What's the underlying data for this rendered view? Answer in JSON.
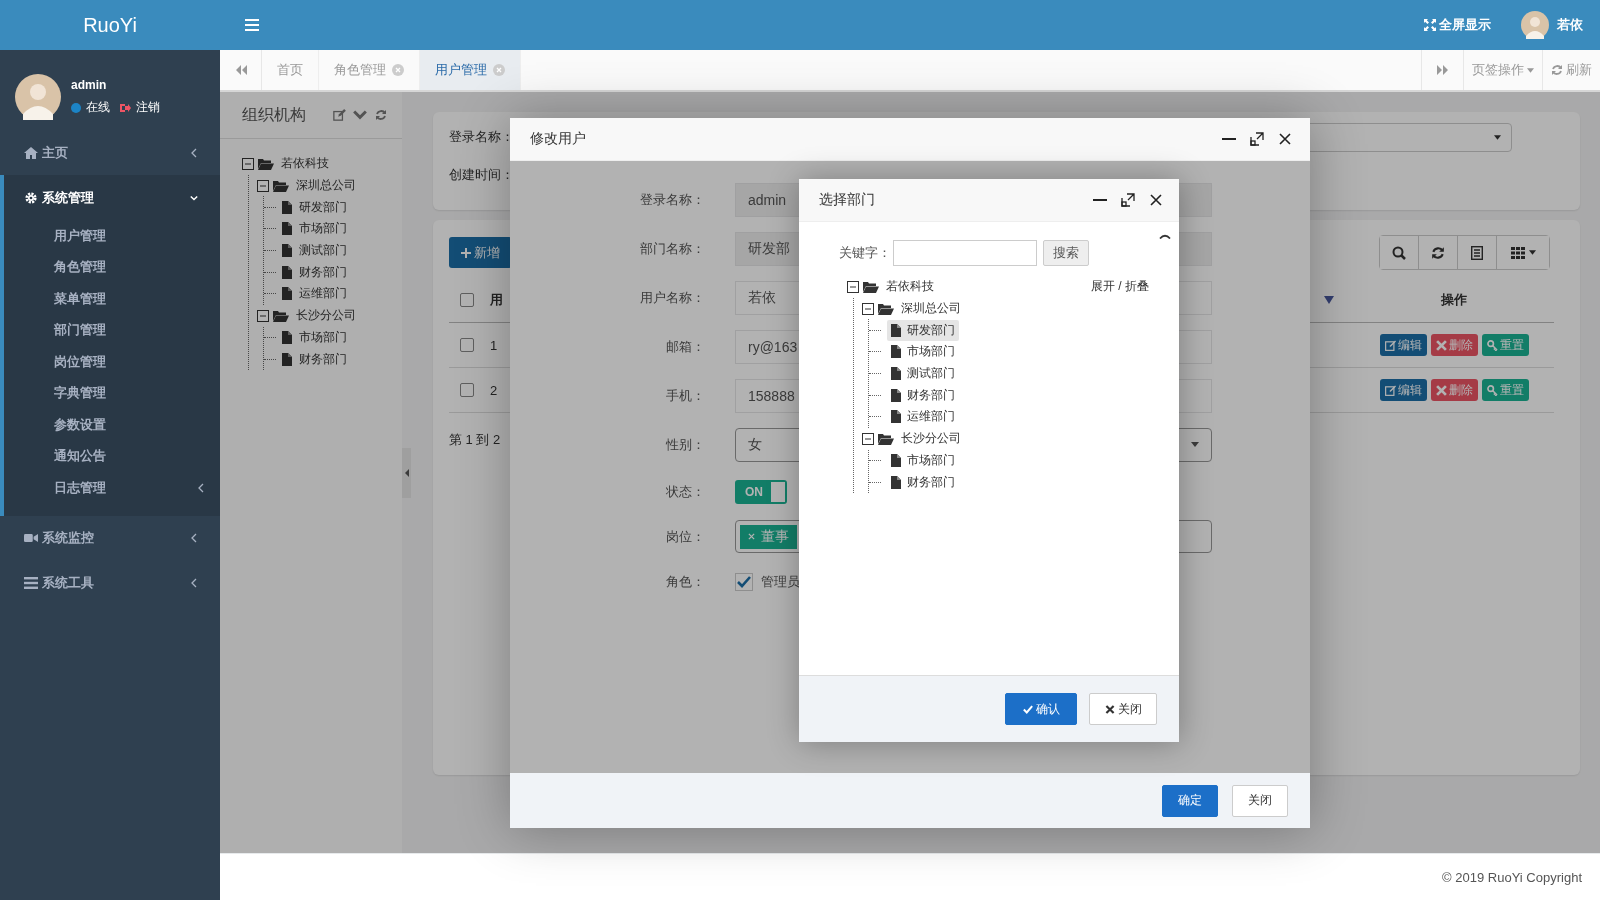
{
  "sidebar": {
    "logo": "RuoYi",
    "user": {
      "name": "admin",
      "status": "在线",
      "logout": "注销"
    },
    "menu": [
      {
        "label": "主页",
        "selected": false,
        "expanded": false
      },
      {
        "label": "系统管理",
        "selected": true,
        "expanded": true,
        "children": [
          {
            "label": "用户管理",
            "selected": false
          },
          {
            "label": "角色管理",
            "selected": false
          },
          {
            "label": "菜单管理",
            "selected": false
          },
          {
            "label": "部门管理",
            "selected": false
          },
          {
            "label": "岗位管理",
            "selected": false
          },
          {
            "label": "字典管理",
            "selected": false
          },
          {
            "label": "参数设置",
            "selected": false
          },
          {
            "label": "通知公告",
            "selected": false
          },
          {
            "label": "日志管理",
            "selected": false,
            "expanded": false
          }
        ]
      },
      {
        "label": "系统监控",
        "selected": false,
        "expanded": false
      },
      {
        "label": "系统工具",
        "selected": false,
        "expanded": false
      }
    ]
  },
  "header": {
    "fullscreen": "全屏显示",
    "user_name": "若依"
  },
  "tabs": [
    {
      "label": "首页",
      "closable": false,
      "selected": false
    },
    {
      "label": "角色管理",
      "closable": true,
      "selected": false
    },
    {
      "label": "用户管理",
      "closable": true,
      "selected": true
    }
  ],
  "tab_actions": {
    "menu": "页签操作",
    "refresh": "刷新"
  },
  "dept_panel": {
    "title": "组织机构",
    "tree": [
      {
        "label": "若依科技",
        "expanded": true,
        "children": [
          {
            "label": "深圳总公司",
            "expanded": true,
            "children": [
              {
                "label": "研发部门"
              },
              {
                "label": "市场部门"
              },
              {
                "label": "测试部门"
              },
              {
                "label": "财务部门"
              },
              {
                "label": "运维部门"
              }
            ]
          },
          {
            "label": "长沙分公司",
            "expanded": true,
            "children": [
              {
                "label": "市场部门"
              },
              {
                "label": "财务部门"
              }
            ]
          }
        ]
      }
    ]
  },
  "search_form": {
    "fields": [
      {
        "label": "登录名称："
      },
      {
        "label": "创建时间："
      }
    ]
  },
  "table": {
    "add_button": "新增",
    "header_checked": false,
    "columns": [
      {
        "label": "用"
      },
      {
        "label": "操作"
      }
    ],
    "rows": [
      {
        "index": "1",
        "checked": false,
        "actions": [
          {
            "label": "编辑",
            "kind": "edit"
          },
          {
            "label": "删除",
            "kind": "delete"
          },
          {
            "label": "重置",
            "kind": "reset"
          }
        ]
      },
      {
        "index": "2",
        "checked": false,
        "actions": [
          {
            "label": "编辑",
            "kind": "edit"
          },
          {
            "label": "删除",
            "kind": "delete"
          },
          {
            "label": "重置",
            "kind": "reset"
          }
        ]
      }
    ],
    "pager": "第 1 到 2"
  },
  "edit_user_dialog": {
    "title": "修改用户",
    "fields": [
      {
        "label": "登录名称：",
        "kind": "readonly",
        "value": "admin"
      },
      {
        "label": "部门名称：",
        "kind": "readonly",
        "value": "研发部"
      },
      {
        "label": "用户名称：",
        "kind": "text",
        "value": "若依"
      },
      {
        "label": "邮箱：",
        "kind": "text",
        "value": "ry@163"
      },
      {
        "label": "手机：",
        "kind": "text",
        "value": "158888"
      },
      {
        "label": "性别：",
        "kind": "select",
        "value": "女"
      },
      {
        "label": "状态：",
        "kind": "switch",
        "on": true,
        "value": "ON"
      },
      {
        "label": "岗位：",
        "kind": "tags",
        "value": "董事"
      },
      {
        "label": "角色：",
        "kind": "checkbox",
        "checked": true,
        "value": "管理员"
      }
    ],
    "buttons": [
      {
        "label": "确定",
        "kind": "primary"
      },
      {
        "label": "关闭",
        "kind": "default"
      }
    ]
  },
  "select_dept_dialog": {
    "title": "选择部门",
    "keyword_label": "关键字：",
    "search_button": "搜索",
    "toggle": "展开 / 折叠",
    "tree": [
      {
        "label": "若依科技",
        "expanded": true,
        "selected": false,
        "children": [
          {
            "label": "深圳总公司",
            "expanded": true,
            "selected": false,
            "children": [
              {
                "label": "研发部门",
                "selected": true
              },
              {
                "label": "市场部门",
                "selected": false
              },
              {
                "label": "测试部门",
                "selected": false
              },
              {
                "label": "财务部门",
                "selected": false
              },
              {
                "label": "运维部门",
                "selected": false
              }
            ]
          },
          {
            "label": "长沙分公司",
            "expanded": true,
            "selected": false,
            "children": [
              {
                "label": "市场部门",
                "selected": false
              },
              {
                "label": "财务部门",
                "selected": false
              }
            ]
          }
        ]
      }
    ],
    "buttons": [
      {
        "label": "确认",
        "kind": "primary"
      },
      {
        "label": "关闭",
        "kind": "default"
      }
    ]
  },
  "footer": "© 2019 RuoYi Copyright"
}
